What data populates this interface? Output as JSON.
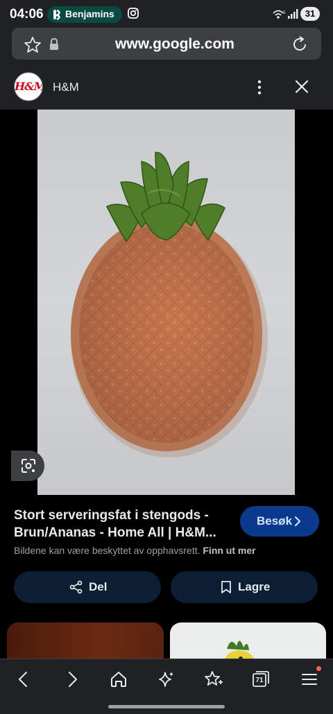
{
  "status": {
    "time": "04:06",
    "notification_app": "Benjamins",
    "battery": "31"
  },
  "browser": {
    "url": "www.google.com",
    "tab_count": "71"
  },
  "header": {
    "site_name": "H&M",
    "logo_text": "H&M"
  },
  "result": {
    "title_line1": "Stort serveringsfat i stengods -",
    "title_line2": "Brun/Ananas - Home All | H&M...",
    "visit_label": "Besøk",
    "copyright_text": "Bildene kan være beskyttet av opphavsrett.",
    "learn_more": "Finn ut mer",
    "share_label": "Del",
    "save_label": "Lagre"
  },
  "colors": {
    "accent": "#0b3a8c",
    "brand_red": "#cc071e",
    "plate": "#c97a55",
    "leaves": "#4f7d2a"
  }
}
